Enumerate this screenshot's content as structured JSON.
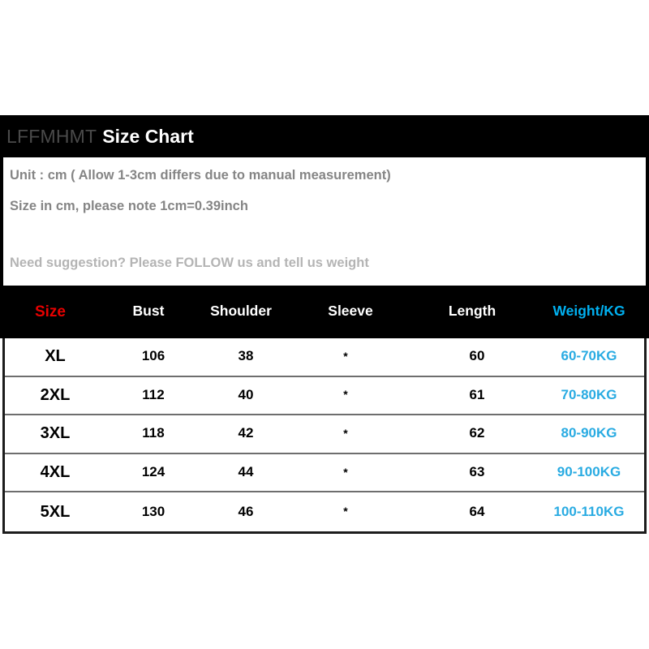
{
  "header": {
    "brand": "LFFMHMT",
    "title": "Size Chart"
  },
  "info": {
    "line1": "Unit : cm ( Allow 1-3cm differs due to manual measurement)",
    "line2": "Size in cm, please note 1cm=0.39inch",
    "line3": "Need suggestion? Please FOLLOW us and tell us weight"
  },
  "colors": {
    "background": "#000000",
    "panel": "#ffffff",
    "brand_text": "#4a4a4a",
    "title_text": "#ffffff",
    "info_text": "#858585",
    "info_text_faint": "#b4b4b4",
    "size_header": "#e60000",
    "weight_header": "#00b0f0",
    "weight_cell": "#29abe2",
    "cell_text": "#000000",
    "row_divider": "#6e6e6e"
  },
  "chart_data": {
    "type": "table",
    "title": "Size Chart",
    "columns": [
      "Size",
      "Bust",
      "Shoulder",
      "Sleeve",
      "Length",
      "Weight/KG"
    ],
    "rows": [
      {
        "size": "XL",
        "bust": "106",
        "shoulder": "38",
        "sleeve": "*",
        "length": "60",
        "weight": "60-70KG"
      },
      {
        "size": "2XL",
        "bust": "112",
        "shoulder": "40",
        "sleeve": "*",
        "length": "61",
        "weight": "70-80KG"
      },
      {
        "size": "3XL",
        "bust": "118",
        "shoulder": "42",
        "sleeve": "*",
        "length": "62",
        "weight": "80-90KG"
      },
      {
        "size": "4XL",
        "bust": "124",
        "shoulder": "44",
        "sleeve": "*",
        "length": "63",
        "weight": "90-100KG"
      },
      {
        "size": "5XL",
        "bust": "130",
        "shoulder": "46",
        "sleeve": "*",
        "length": "64",
        "weight": "100-110KG"
      }
    ],
    "units": "cm",
    "notes": [
      "Unit : cm ( Allow 1-3cm differs due to manual measurement)",
      "Size in cm, please note 1cm=0.39inch",
      "Need suggestion? Please FOLLOW us and tell us weight"
    ]
  }
}
